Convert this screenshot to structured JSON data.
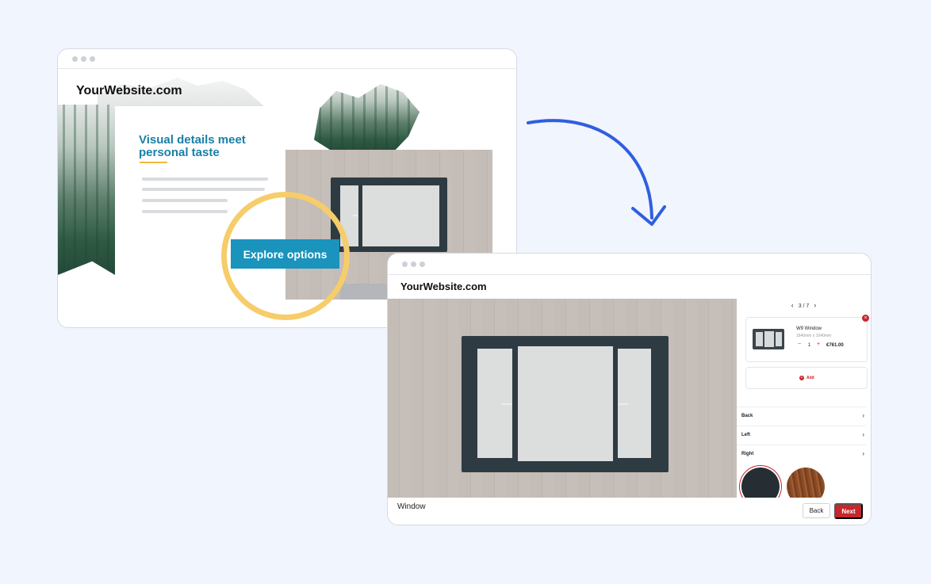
{
  "colors": {
    "background": "#f1f5fd",
    "accent_blue": "#1a93bd",
    "heading_blue": "#1a7fa8",
    "highlight_ring": "#f6cd6a",
    "arrow_blue": "#2f5fe0",
    "next_red": "#c6262c",
    "frame_dark": "#2f3b42"
  },
  "landing_page": {
    "site_title": "YourWebsite.com",
    "heading_line1": "Visual details meet",
    "heading_line2": "personal taste",
    "cta_label": "Explore options"
  },
  "configurator": {
    "site_title": "YourWebsite.com",
    "pager": {
      "prev_icon": "chevron-left-icon",
      "text": "3 / 7",
      "next_icon": "chevron-right-icon"
    },
    "item": {
      "name": "W9 Window",
      "dimensions": "1640mm x 1040mm",
      "quantity": "1",
      "price": "€761.00",
      "remove_icon": "close-icon"
    },
    "add_label": "Add",
    "sections": [
      {
        "label": "Back"
      },
      {
        "label": "Left"
      },
      {
        "label": "Right"
      }
    ],
    "swatches": [
      {
        "name": "anthracite",
        "color": "#262d33"
      },
      {
        "name": "wood",
        "color": "#8a4d27"
      }
    ],
    "footer_label": "Window",
    "back_button": "Back",
    "next_button": "Next"
  }
}
